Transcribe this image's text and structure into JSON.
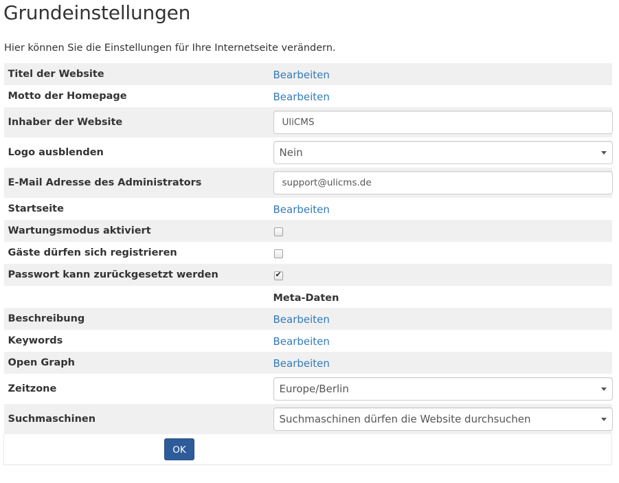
{
  "header": {
    "title": "Grundeinstellungen",
    "intro": "Hier können Sie die Einstellungen für Ihre Internetseite verändern."
  },
  "settings": {
    "site_title": {
      "label": "Titel der Website",
      "action": "Bearbeiten"
    },
    "motto": {
      "label": "Motto der Homepage",
      "action": "Bearbeiten"
    },
    "owner": {
      "label": "Inhaber der Website",
      "value": "UliCMS"
    },
    "hide_logo": {
      "label": "Logo ausblenden",
      "value": "Nein"
    },
    "admin_email": {
      "label": "E-Mail Adresse des Administrators",
      "value": "support@ulicms.de"
    },
    "start_page": {
      "label": "Startseite",
      "action": "Bearbeiten"
    },
    "maintenance": {
      "label": "Wartungsmodus aktiviert",
      "checked": false
    },
    "guest_registration": {
      "label": "Gäste dürfen sich registrieren",
      "checked": false
    },
    "password_reset": {
      "label": "Passwort kann zurückgesetzt werden",
      "checked": true
    },
    "meta_heading": "Meta-Daten",
    "description": {
      "label": "Beschreibung",
      "action": "Bearbeiten"
    },
    "keywords": {
      "label": "Keywords",
      "action": "Bearbeiten"
    },
    "open_graph": {
      "label": "Open Graph",
      "action": "Bearbeiten"
    },
    "timezone": {
      "label": "Zeitzone",
      "value": "Europe/Berlin"
    },
    "search_engines": {
      "label": "Suchmaschinen",
      "value": "Suchmaschinen dürfen die Website durchsuchen"
    }
  },
  "footer": {
    "ok_label": "OK"
  },
  "colors": {
    "link": "#337ab7",
    "ok_button": "#2e5b9a",
    "stripe": "#f0f0f0"
  },
  "icons": {
    "checkbox_checked": "checkmark",
    "select_caret": "caret-down"
  }
}
